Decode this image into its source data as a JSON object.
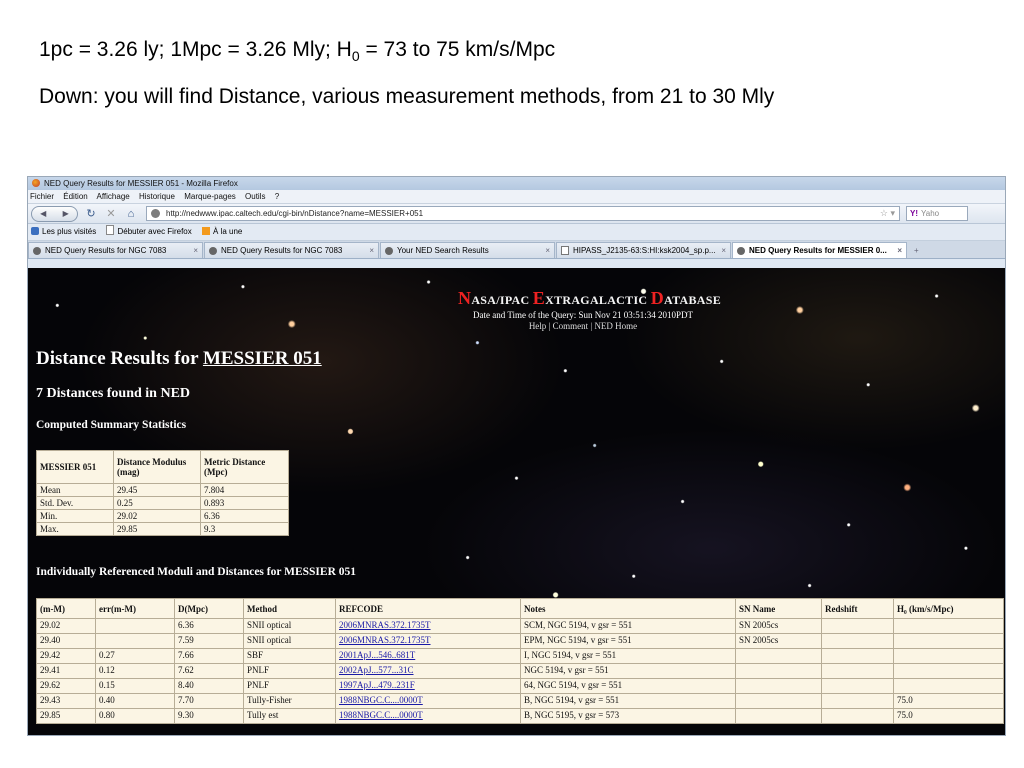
{
  "slide": {
    "line1_pre": "1pc = 3.26 ly; 1Mpc = 3.26 Mly; H",
    "line1_sub": "0",
    "line1_post": " = 73 to 75 km/s/Mpc",
    "line2": "Down: you will find Distance, various measurement methods, from 21 to 30 Mly"
  },
  "browser": {
    "window_title": "NED Query Results for MESSIER 051 - Mozilla Firefox",
    "menu": [
      "Fichier",
      "Édition",
      "Affichage",
      "Historique",
      "Marque-pages",
      "Outils",
      "?"
    ],
    "url": "http://nedwww.ipac.caltech.edu/cgi-bin/nDistance?name=MESSIER+051",
    "search_placeholder": "Yaho",
    "bookmarks": [
      "Les plus visités",
      "Débuter avec Firefox",
      "À la une"
    ],
    "tabs": [
      {
        "label": "NED Query Results for NGC 7083",
        "icon": "globe",
        "active": false
      },
      {
        "label": "NED Query Results for NGC 7083",
        "icon": "globe",
        "active": false
      },
      {
        "label": "Your NED Search Results",
        "icon": "globe",
        "active": false
      },
      {
        "label": "HIPASS_J2135-63:S:HI:ksk2004_sp.p...",
        "icon": "doc",
        "active": false
      },
      {
        "label": "NED Query Results for MESSIER 0...",
        "icon": "globe",
        "active": true
      }
    ]
  },
  "ned": {
    "title_n": "N",
    "title_asa": "ASA/IPAC ",
    "title_e": "E",
    "title_xtra": "XTRAGALACTIC ",
    "title_d": "D",
    "title_atabase": "ATABASE",
    "date_line": "Date and Time of the Query: Sun Nov 21 03:51:34 2010PDT",
    "links": [
      "Help",
      "Comment",
      "NED Home"
    ],
    "heading_prefix": "Distance Results for ",
    "object_link": "MESSIER 051",
    "count_heading": "7 Distances found in NED",
    "summary_heading": "Computed Summary Statistics",
    "refs_heading": "Individually Referenced Moduli and Distances for MESSIER 051"
  },
  "summary": {
    "headers": [
      "MESSIER 051",
      "Distance Modulus (mag)",
      "Metric Distance (Mpc)"
    ],
    "rows": [
      [
        "Mean",
        "29.45",
        "7.804"
      ],
      [
        "Std. Dev.",
        "0.25",
        "0.893"
      ],
      [
        "Min.",
        "29.02",
        "6.36"
      ],
      [
        "Max.",
        "29.85",
        "9.3"
      ]
    ]
  },
  "refs": {
    "headers": [
      "(m-M)",
      "err(m-M)",
      "D(Mpc)",
      "Method",
      "REFCODE",
      "Notes",
      "SN Name",
      "Redshift",
      "H₀ (km/s/Mpc)"
    ],
    "rows": [
      [
        "29.02",
        "",
        "6.36",
        "SNII optical",
        "2006MNRAS.372.1735T",
        "SCM, NGC 5194, v gsr = 551",
        "SN 2005cs",
        "",
        ""
      ],
      [
        "29.40",
        "",
        "7.59",
        "SNII optical",
        "2006MNRAS.372.1735T",
        "EPM, NGC 5194, v gsr = 551",
        "SN 2005cs",
        "",
        ""
      ],
      [
        "29.42",
        "0.27",
        "7.66",
        "SBF",
        "2001ApJ...546..681T",
        "I, NGC 5194, v gsr = 551",
        "",
        "",
        ""
      ],
      [
        "29.41",
        "0.12",
        "7.62",
        "PNLF",
        "2002ApJ...577...31C",
        "NGC 5194, v gsr = 551",
        "",
        "",
        ""
      ],
      [
        "29.62",
        "0.15",
        "8.40",
        "PNLF",
        "1997ApJ...479..231F",
        "64, NGC 5194, v gsr = 551",
        "",
        "",
        ""
      ],
      [
        "29.43",
        "0.40",
        "7.70",
        "Tully-Fisher",
        "1988NBGC.C....0000T",
        "B, NGC 5194, v gsr = 551",
        "",
        "",
        "75.0"
      ],
      [
        "29.85",
        "0.80",
        "9.30",
        "Tully est",
        "1988NBGC.C....0000T",
        "B, NGC 5195, v gsr = 573",
        "",
        "",
        "75.0"
      ]
    ]
  }
}
